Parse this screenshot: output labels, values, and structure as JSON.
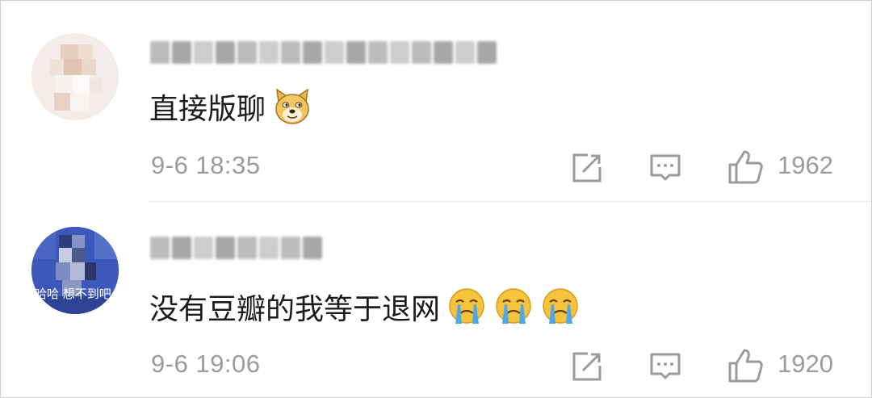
{
  "comments": [
    {
      "avatar_caption": "",
      "username": "",
      "text": "直接版聊",
      "emojis": [
        "doge-emoji"
      ],
      "time": "9-6 18:35",
      "likes": "1962"
    },
    {
      "avatar_caption": "哈哈 想不到吧",
      "username": "",
      "text": "没有豆瓣的我等于退网",
      "emojis": [
        "crying-emoji",
        "crying-emoji",
        "crying-emoji"
      ],
      "time": "9-6 19:06",
      "likes": "1920"
    }
  ],
  "icons": {
    "share": "share-icon",
    "reply": "comment-icon",
    "like": "thumbs-up-icon"
  },
  "colors": {
    "meta_text": "#9b9b9b",
    "body_text": "#1c1c1c",
    "divider": "#e8e8e8"
  }
}
